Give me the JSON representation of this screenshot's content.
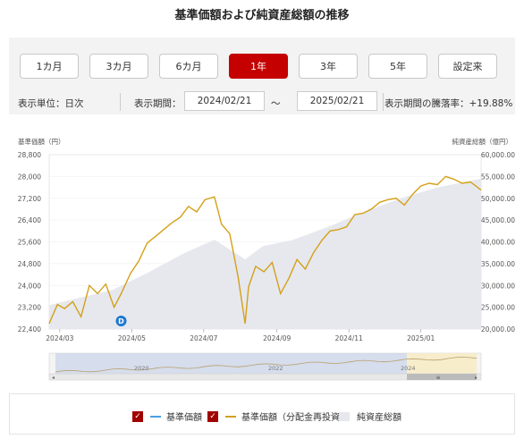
{
  "page_title": "基準価額および純資産総額の推移",
  "period_tabs": [
    {
      "label": "1カ月",
      "active": false
    },
    {
      "label": "3カ月",
      "active": false
    },
    {
      "label": "6カ月",
      "active": false
    },
    {
      "label": "1年",
      "active": true
    },
    {
      "label": "3年",
      "active": false
    },
    {
      "label": "5年",
      "active": false
    },
    {
      "label": "設定来",
      "active": false
    }
  ],
  "controls": {
    "unit_label": "表示単位：日次",
    "period_label": "表示期間：",
    "start_date": "2024/02/21",
    "tilde": "〜",
    "end_date": "2025/02/21",
    "change_label": "表示期間の騰落率：+19.88%"
  },
  "colors": {
    "accent": "#c40000",
    "nav_line": "#d4a017",
    "nav_base_line": "#4aa0e6",
    "area_fill": "#e6e8ee",
    "dividend_marker": "#1e78d2"
  },
  "legend": {
    "items": [
      {
        "label": "基準価額",
        "type": "line",
        "color": "#4aa0e6",
        "checked": true
      },
      {
        "label": "基準価額（分配金再投資）",
        "type": "line",
        "color": "#d4a017",
        "checked": true
      },
      {
        "label": "純資産総額",
        "type": "area",
        "color": "#e6e8ee"
      }
    ]
  },
  "chart_data": {
    "type": "line",
    "left_axis": {
      "label": "基準価額（円）",
      "ticks": [
        "28,800",
        "28,000",
        "27,200",
        "26,400",
        "25,600",
        "24,800",
        "24,000",
        "23,200",
        "22,400"
      ],
      "range": [
        22400,
        28800
      ]
    },
    "right_axis": {
      "label": "純資産総額（億円）",
      "ticks": [
        "60,000.00",
        "55,000.00",
        "50,000.00",
        "45,000.00",
        "40,000.00",
        "35,000.00",
        "30,000.00",
        "25,000.00",
        "20,000.00"
      ],
      "range": [
        20000,
        60000
      ]
    },
    "x_axis": {
      "ticks": [
        "2024/03",
        "2024/05",
        "2024/07",
        "2024/09",
        "2024/11",
        "2025/01"
      ]
    },
    "navigator_ticks": [
      "2020",
      "2022",
      "2024"
    ],
    "dividend_marker": {
      "label": "D",
      "x": "2024/04/22"
    },
    "series": [
      {
        "name": "基準価額（分配金再投資）",
        "axis": "left",
        "points": [
          [
            "2024/02/21",
            22600
          ],
          [
            "2024/02/28",
            23300
          ],
          [
            "2024/03/05",
            23150
          ],
          [
            "2024/03/12",
            23400
          ],
          [
            "2024/03/19",
            22850
          ],
          [
            "2024/03/26",
            24000
          ],
          [
            "2024/04/02",
            23700
          ],
          [
            "2024/04/09",
            24050
          ],
          [
            "2024/04/16",
            23200
          ],
          [
            "2024/04/22",
            23700
          ],
          [
            "2024/04/30",
            24450
          ],
          [
            "2024/05/07",
            24900
          ],
          [
            "2024/05/14",
            25550
          ],
          [
            "2024/05/21",
            25800
          ],
          [
            "2024/05/28",
            26050
          ],
          [
            "2024/06/04",
            26300
          ],
          [
            "2024/06/11",
            26500
          ],
          [
            "2024/06/18",
            26900
          ],
          [
            "2024/06/25",
            26700
          ],
          [
            "2024/07/02",
            27150
          ],
          [
            "2024/07/10",
            27250
          ],
          [
            "2024/07/16",
            26250
          ],
          [
            "2024/07/23",
            25900
          ],
          [
            "2024/07/30",
            24350
          ],
          [
            "2024/08/05",
            22600
          ],
          [
            "2024/08/08",
            23950
          ],
          [
            "2024/08/14",
            24700
          ],
          [
            "2024/08/21",
            24500
          ],
          [
            "2024/08/28",
            24850
          ],
          [
            "2024/09/04",
            23700
          ],
          [
            "2024/09/11",
            24250
          ],
          [
            "2024/09/18",
            24950
          ],
          [
            "2024/09/25",
            24600
          ],
          [
            "2024/10/02",
            25200
          ],
          [
            "2024/10/09",
            25650
          ],
          [
            "2024/10/16",
            26000
          ],
          [
            "2024/10/23",
            26050
          ],
          [
            "2024/10/30",
            26150
          ],
          [
            "2024/11/06",
            26600
          ],
          [
            "2024/11/13",
            26650
          ],
          [
            "2024/11/20",
            26800
          ],
          [
            "2024/11/27",
            27050
          ],
          [
            "2024/12/04",
            27150
          ],
          [
            "2024/12/11",
            27200
          ],
          [
            "2024/12/18",
            26950
          ],
          [
            "2024/12/25",
            27350
          ],
          [
            "2025/01/01",
            27650
          ],
          [
            "2025/01/08",
            27750
          ],
          [
            "2025/01/15",
            27700
          ],
          [
            "2025/01/22",
            28000
          ],
          [
            "2025/01/29",
            27900
          ],
          [
            "2025/02/05",
            27750
          ],
          [
            "2025/02/12",
            27800
          ],
          [
            "2025/02/21",
            27500
          ]
        ]
      },
      {
        "name": "純資産総額",
        "axis": "right",
        "points": [
          [
            "2024/02/21",
            25500
          ],
          [
            "2024/03/15",
            27000
          ],
          [
            "2024/04/15",
            29000
          ],
          [
            "2024/05/15",
            33000
          ],
          [
            "2024/06/15",
            37500
          ],
          [
            "2024/07/10",
            40500
          ],
          [
            "2024/08/05",
            36000
          ],
          [
            "2024/08/20",
            39000
          ],
          [
            "2024/09/15",
            40500
          ],
          [
            "2024/10/15",
            43500
          ],
          [
            "2024/11/15",
            47000
          ],
          [
            "2024/12/15",
            50000
          ],
          [
            "2025/01/15",
            52500
          ],
          [
            "2025/02/21",
            54500
          ]
        ]
      }
    ]
  }
}
